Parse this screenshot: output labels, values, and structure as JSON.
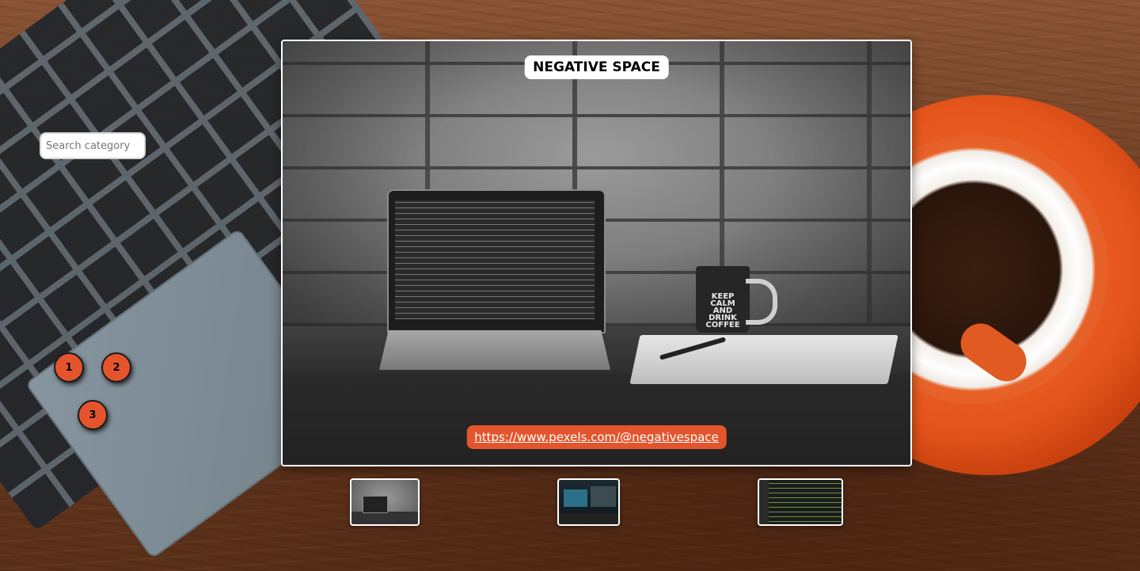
{
  "search": {
    "placeholder": "Search category",
    "value": ""
  },
  "pagination": {
    "pages": [
      "1",
      "2",
      "3"
    ]
  },
  "viewer": {
    "caption": "NEGATIVE SPACE",
    "credit_link": "https://www.pexels.com/@negativespace",
    "mug_text": "KEEP CALM AND DRINK COFFEE"
  },
  "thumbnails": [
    {
      "name": "laptop-on-desk"
    },
    {
      "name": "dual-monitor-desk"
    },
    {
      "name": "code-editor-screen"
    }
  ],
  "colors": {
    "accent": "#e4552d",
    "caption_bg": "#ffffff",
    "thumb_border": "#ffffff"
  }
}
